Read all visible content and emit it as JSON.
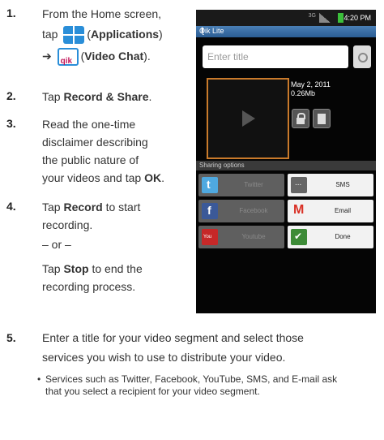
{
  "steps": {
    "s1": {
      "num": "1.",
      "line1": "From the Home screen,",
      "tap": "tap",
      "apps_label": "Applications",
      "arrow": "➔",
      "video_label": "Video Chat"
    },
    "s2": {
      "num": "2.",
      "pre": "Tap",
      "bold": "Record & Share",
      "post": "."
    },
    "s3": {
      "num": "3.",
      "l1": "Read the one-time",
      "l2": "disclaimer describing",
      "l3": "the public nature of",
      "l4a": "your videos and tap",
      "l4b": "OK",
      "l4c": "."
    },
    "s4": {
      "num": "4.",
      "l1a": "Tap",
      "l1b": "Record",
      "l1c": "to start",
      "l2": "recording.",
      "or": "– or –",
      "l3a": "Tap",
      "l3b": "Stop",
      "l3c": "to end the",
      "l4": "recording process."
    },
    "s5": {
      "num": "5.",
      "l1": "Enter a title for your video segment and select those",
      "l2": "services you wish to use to distribute your video."
    },
    "bullet": {
      "l1": "Services such as Twitter, Facebook, YouTube, SMS, and E-mail ask",
      "l2": "that you select a recipient for your video segment."
    }
  },
  "phone": {
    "status": {
      "net": "3G",
      "time": "4:20 PM"
    },
    "app_title": "Qik Lite",
    "title_placeholder": "Enter title",
    "date": "May 2, 2011",
    "size": "0.26Mb",
    "sharing_header": "Sharing options",
    "buttons": {
      "twitter": "Twitter",
      "sms": "SMS",
      "facebook": "Facebook",
      "email": "Email",
      "youtube": "Youtube",
      "done": "Done"
    }
  }
}
